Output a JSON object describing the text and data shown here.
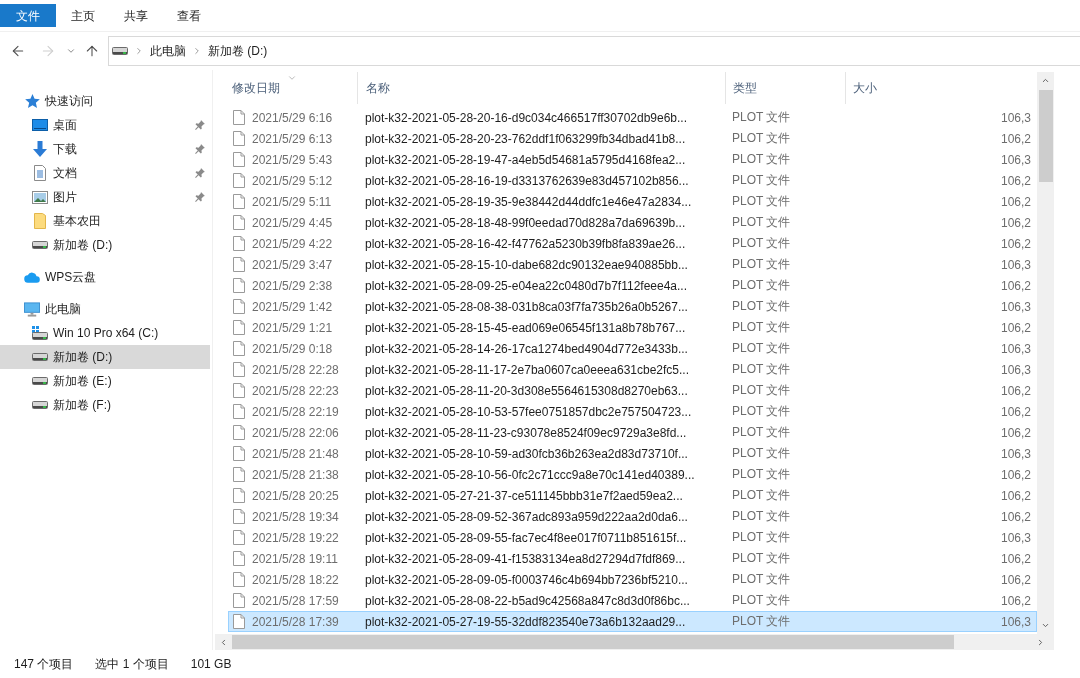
{
  "ribbon": {
    "tabs": [
      {
        "label": "文件",
        "kind": "file",
        "selected": false
      },
      {
        "label": "主页",
        "kind": "tab",
        "selected": false
      },
      {
        "label": "共享",
        "kind": "tab",
        "selected": false
      },
      {
        "label": "查看",
        "kind": "tab",
        "selected": false
      }
    ]
  },
  "navigation": {
    "buttons": [
      {
        "kind": "back",
        "disabled": false
      },
      {
        "kind": "forward",
        "disabled": true
      },
      {
        "kind": "recent",
        "disabled": false
      },
      {
        "kind": "up",
        "disabled": false
      }
    ],
    "address": {
      "crumbs": [
        "此电脑",
        "新加卷 (D:)"
      ]
    }
  },
  "sidebar": {
    "items": [
      {
        "label": "快速访问",
        "kind": "quick-access",
        "selected": false,
        "children": [
          {
            "label": "桌面",
            "kind": "desktop",
            "pinned": true,
            "selected": false
          },
          {
            "label": "下载",
            "kind": "downloads",
            "pinned": true,
            "selected": false
          },
          {
            "label": "文档",
            "kind": "documents",
            "pinned": true,
            "selected": false
          },
          {
            "label": "图片",
            "kind": "pictures",
            "pinned": true,
            "selected": false
          },
          {
            "label": "基本农田",
            "kind": "folder",
            "pinned": false,
            "selected": false
          },
          {
            "label": "新加卷 (D:)",
            "kind": "drive",
            "pinned": false,
            "selected": false
          }
        ]
      },
      {
        "label": "WPS云盘",
        "kind": "cloud",
        "selected": false
      },
      {
        "label": "此电脑",
        "kind": "computer",
        "selected": false,
        "children": [
          {
            "label": "Win 10 Pro x64 (C:)",
            "kind": "system-drive",
            "selected": false
          },
          {
            "label": "新加卷 (D:)",
            "kind": "drive",
            "selected": true
          },
          {
            "label": "新加卷 (E:)",
            "kind": "drive",
            "selected": false
          },
          {
            "label": "新加卷 (F:)",
            "kind": "drive",
            "selected": false
          }
        ]
      }
    ]
  },
  "table": {
    "columns": [
      {
        "label": "修改日期",
        "sorted": true
      },
      {
        "label": "名称",
        "sorted": false
      },
      {
        "label": "类型",
        "sorted": false
      },
      {
        "label": "大小",
        "sorted": false
      }
    ],
    "rows": [
      {
        "modified": "2021/5/29 6:16",
        "name": "plot-k32-2021-05-28-20-16-d9c034c466517ff30702db9e6b...",
        "type": "PLOT 文件",
        "size": "106,3",
        "selected": false
      },
      {
        "modified": "2021/5/29 6:13",
        "name": "plot-k32-2021-05-28-20-23-762ddf1f063299fb34dbad41b8...",
        "type": "PLOT 文件",
        "size": "106,2",
        "selected": false
      },
      {
        "modified": "2021/5/29 5:43",
        "name": "plot-k32-2021-05-28-19-47-a4eb5d54681a5795d4168fea2...",
        "type": "PLOT 文件",
        "size": "106,3",
        "selected": false
      },
      {
        "modified": "2021/5/29 5:12",
        "name": "plot-k32-2021-05-28-16-19-d3313762639e83d457102b856...",
        "type": "PLOT 文件",
        "size": "106,2",
        "selected": false
      },
      {
        "modified": "2021/5/29 5:11",
        "name": "plot-k32-2021-05-28-19-35-9e38442d44ddfc1e46e47a2834...",
        "type": "PLOT 文件",
        "size": "106,2",
        "selected": false
      },
      {
        "modified": "2021/5/29 4:45",
        "name": "plot-k32-2021-05-28-18-48-99f0eedad70d828a7da69639b...",
        "type": "PLOT 文件",
        "size": "106,2",
        "selected": false
      },
      {
        "modified": "2021/5/29 4:22",
        "name": "plot-k32-2021-05-28-16-42-f47762a5230b39fb8fa839ae26...",
        "type": "PLOT 文件",
        "size": "106,2",
        "selected": false
      },
      {
        "modified": "2021/5/29 3:47",
        "name": "plot-k32-2021-05-28-15-10-dabe682dc90132eae940885bb...",
        "type": "PLOT 文件",
        "size": "106,3",
        "selected": false
      },
      {
        "modified": "2021/5/29 2:38",
        "name": "plot-k32-2021-05-28-09-25-e04ea22c0480d7b7f112feee4a...",
        "type": "PLOT 文件",
        "size": "106,2",
        "selected": false
      },
      {
        "modified": "2021/5/29 1:42",
        "name": "plot-k32-2021-05-28-08-38-031b8ca03f7fa735b26a0b5267...",
        "type": "PLOT 文件",
        "size": "106,3",
        "selected": false
      },
      {
        "modified": "2021/5/29 1:21",
        "name": "plot-k32-2021-05-28-15-45-ead069e06545f131a8b78b767...",
        "type": "PLOT 文件",
        "size": "106,2",
        "selected": false
      },
      {
        "modified": "2021/5/29 0:18",
        "name": "plot-k32-2021-05-28-14-26-17ca1274bed4904d772e3433b...",
        "type": "PLOT 文件",
        "size": "106,3",
        "selected": false
      },
      {
        "modified": "2021/5/28 22:28",
        "name": "plot-k32-2021-05-28-11-17-2e7ba0607ca0eeea631cbe2fc5...",
        "type": "PLOT 文件",
        "size": "106,3",
        "selected": false
      },
      {
        "modified": "2021/5/28 22:23",
        "name": "plot-k32-2021-05-28-11-20-3d308e5564615308d8270eb63...",
        "type": "PLOT 文件",
        "size": "106,2",
        "selected": false
      },
      {
        "modified": "2021/5/28 22:19",
        "name": "plot-k32-2021-05-28-10-53-57fee0751857dbc2e757504723...",
        "type": "PLOT 文件",
        "size": "106,2",
        "selected": false
      },
      {
        "modified": "2021/5/28 22:06",
        "name": "plot-k32-2021-05-28-11-23-c93078e8524f09ec9729a3e8fd...",
        "type": "PLOT 文件",
        "size": "106,2",
        "selected": false
      },
      {
        "modified": "2021/5/28 21:48",
        "name": "plot-k32-2021-05-28-10-59-ad30fcb36b263ea2d83d73710f...",
        "type": "PLOT 文件",
        "size": "106,3",
        "selected": false
      },
      {
        "modified": "2021/5/28 21:38",
        "name": "plot-k32-2021-05-28-10-56-0fc2c71ccc9a8e70c141ed40389...",
        "type": "PLOT 文件",
        "size": "106,2",
        "selected": false
      },
      {
        "modified": "2021/5/28 20:25",
        "name": "plot-k32-2021-05-27-21-37-ce511145bbb31e7f2aed59ea2...",
        "type": "PLOT 文件",
        "size": "106,2",
        "selected": false
      },
      {
        "modified": "2021/5/28 19:34",
        "name": "plot-k32-2021-05-28-09-52-367adc893a959d222aa2d0da6...",
        "type": "PLOT 文件",
        "size": "106,2",
        "selected": false
      },
      {
        "modified": "2021/5/28 19:22",
        "name": "plot-k32-2021-05-28-09-55-fac7ec4f8ee017f0711b851615f...",
        "type": "PLOT 文件",
        "size": "106,3",
        "selected": false
      },
      {
        "modified": "2021/5/28 19:11",
        "name": "plot-k32-2021-05-28-09-41-f15383134ea8d27294d7fdf869...",
        "type": "PLOT 文件",
        "size": "106,2",
        "selected": false
      },
      {
        "modified": "2021/5/28 18:22",
        "name": "plot-k32-2021-05-28-09-05-f0003746c4b694bb7236bf5210...",
        "type": "PLOT 文件",
        "size": "106,2",
        "selected": false
      },
      {
        "modified": "2021/5/28 17:59",
        "name": "plot-k32-2021-05-28-08-22-b5ad9c42568a847c8d3d0f86bc...",
        "type": "PLOT 文件",
        "size": "106,2",
        "selected": false
      },
      {
        "modified": "2021/5/28 17:39",
        "name": "plot-k32-2021-05-27-19-55-32ddf823540e73a6b132aad29...",
        "type": "PLOT 文件",
        "size": "106,3",
        "selected": true
      }
    ]
  },
  "status_bar": {
    "item_count": "147 个项目",
    "selection": "选中 1 个项目",
    "selection_size": "101 GB"
  }
}
